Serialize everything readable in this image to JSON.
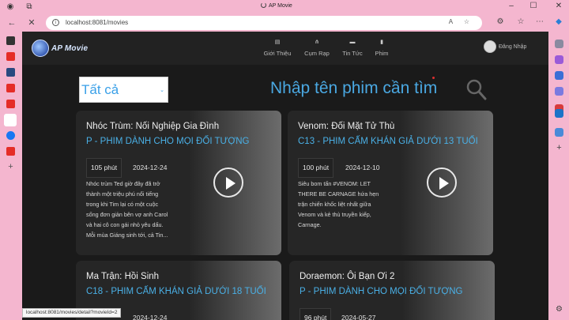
{
  "browser": {
    "tab_title": "AP Movie",
    "url": "localhost:8081/movies",
    "status_url": "localhost:8081/movies/detail?movieId=2"
  },
  "site": {
    "logo_text": "AP Movie",
    "nav": [
      {
        "label": "Giới Thiệu",
        "icon": "info-icon"
      },
      {
        "label": "Cụm Rạp",
        "icon": "network-icon"
      },
      {
        "label": "Tin Tức",
        "icon": "news-icon"
      },
      {
        "label": "Phim",
        "icon": "phone-icon"
      }
    ],
    "login_label": "Đăng Nhập"
  },
  "filter": {
    "selected": "Tất cả",
    "search_placeholder": "Nhập tên phim cần tìm"
  },
  "movies": [
    {
      "title": "Nhóc Trùm: Nối Nghiệp Gia Đình",
      "rating": "P - PHIM DÀNH CHO MỌI ĐỐI TƯỢNG",
      "duration": "105 phút",
      "date": "2024-12-24",
      "desc": "Nhóc trùm Ted giờ đây đã trở thành một triệu phú nổi tiếng trong khi Tim lại có một cuộc sống đơn giản bên vợ anh Carol và hai cô con gái nhỏ yêu dấu. Mỗi mùa Giáng sinh tới, cả Tin..."
    },
    {
      "title": "Venom: Đối Mặt Tử Thù",
      "rating": "C13 - PHIM CẤM KHÁN GIẢ DƯỚI 13 TUỔI",
      "duration": "100 phút",
      "date": "2024-12-10",
      "desc": "Siêu bom tấn #VENOM: LET THERE BE CARNAGE hứa hẹn trận chiến khốc liệt nhất giữa Venom và kẻ thù truyền kiếp, Carnage."
    },
    {
      "title": "Ma Trận: Hồi Sinh",
      "rating": "C18 - PHIM CẤM KHÁN GIẢ DƯỚI 18 TUỔI",
      "duration": "",
      "date": "2024-12-24",
      "desc": ""
    },
    {
      "title": "Doraemon: Ôi Bạn Ơi 2",
      "rating": "P - PHIM DÀNH CHO MỌI ĐỐI TƯỢNG",
      "duration": "96 phút",
      "date": "2024-05-27",
      "desc": ""
    }
  ]
}
